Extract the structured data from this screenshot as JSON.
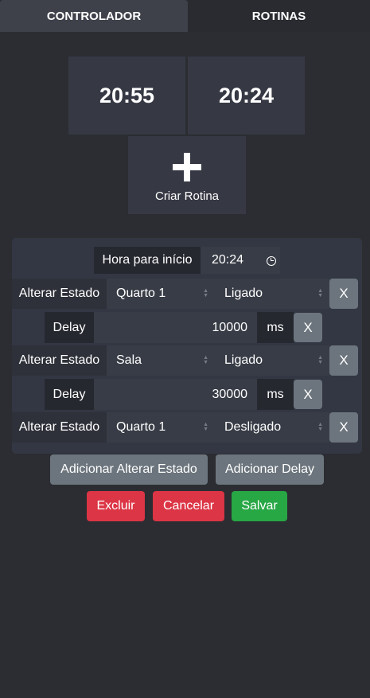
{
  "tabs": {
    "controller": "CONTROLADOR",
    "routines": "ROTINAS"
  },
  "routine_tiles": [
    "20:55",
    "20:24"
  ],
  "create_routine": {
    "label": "Criar Rotina",
    "icon": "plus-icon"
  },
  "editor": {
    "start_time_label": "Hora para início",
    "start_time_value": "20:24",
    "change_state_label": "Alterar Estado",
    "delay_label": "Delay",
    "ms_label": "ms",
    "remove_label": "X",
    "steps": [
      {
        "type": "change_state",
        "room": "Quarto 1",
        "state": "Ligado"
      },
      {
        "type": "delay",
        "value": "10000"
      },
      {
        "type": "change_state",
        "room": "Sala",
        "state": "Ligado"
      },
      {
        "type": "delay",
        "value": "30000"
      },
      {
        "type": "change_state",
        "room": "Quarto 1",
        "state": "Desligado"
      }
    ]
  },
  "actions": {
    "add_change_state": "Adicionar Alterar Estado",
    "add_delay": "Adicionar Delay",
    "delete": "Excluir",
    "cancel": "Cancelar",
    "save": "Salvar"
  },
  "colors": {
    "background": "#2b2d32",
    "tile": "#363944",
    "danger": "#dc3545",
    "success": "#28a745",
    "secondary": "#6c757d"
  }
}
